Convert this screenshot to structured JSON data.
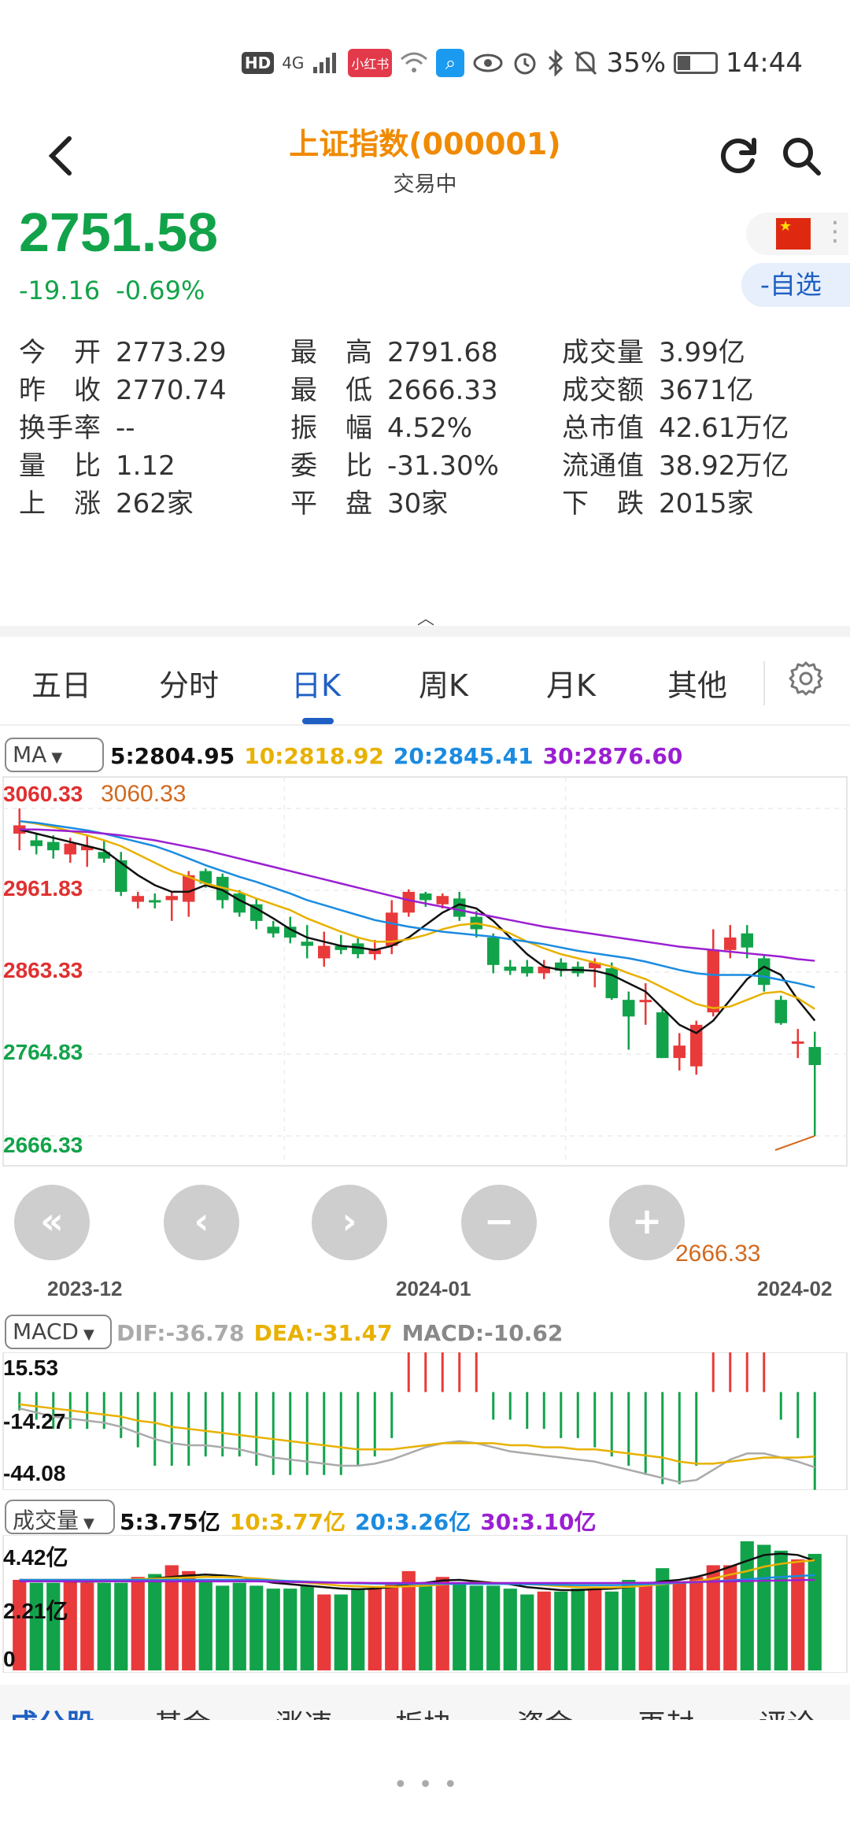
{
  "status_bar": {
    "hd": "HD",
    "network": "4G",
    "battery_pct": "35%",
    "time": "14:44",
    "battery_level": 0.35,
    "app_badge": "小红书"
  },
  "header": {
    "title": "上证指数(000001)",
    "subtitle": "交易中"
  },
  "quote": {
    "price": "2751.58",
    "change": "-19.16",
    "change_pct": "-0.69%",
    "watch_label": "-自选"
  },
  "stats": [
    {
      "label": "今　开",
      "value": "2773.29",
      "color": "#333333"
    },
    {
      "label": "最　高",
      "value": "2791.68",
      "color": "#333333"
    },
    {
      "label": "成交量",
      "value": "3.99亿",
      "color": "#333333"
    },
    {
      "label": "昨　收",
      "value": "2770.74",
      "color": "#333333"
    },
    {
      "label": "最　低",
      "value": "2666.33",
      "color": "#333333"
    },
    {
      "label": "成交额",
      "value": "3671亿",
      "color": "#333333"
    },
    {
      "label": "换手率",
      "value": "--",
      "color": "#333333"
    },
    {
      "label": "振　幅",
      "value": "4.52%",
      "color": "#333333"
    },
    {
      "label": "总市值",
      "value": "42.61万亿",
      "color": "#333333"
    },
    {
      "label": "量　比",
      "value": "1.12",
      "color": "#333333"
    },
    {
      "label": "委　比",
      "value": "-31.30%",
      "color": "#333333"
    },
    {
      "label": "流通值",
      "value": "38.92万亿",
      "color": "#333333"
    },
    {
      "label": "上　涨",
      "value": "262家",
      "color": "#333333"
    },
    {
      "label": "平　盘",
      "value": "30家",
      "color": "#333333"
    },
    {
      "label": "下　跌",
      "value": "2015家",
      "color": "#333333"
    }
  ],
  "tabs": [
    "五日",
    "分时",
    "日K",
    "周K",
    "月K",
    "其他"
  ],
  "active_tab": "日K",
  "ma_panel": {
    "selector": "MA",
    "legend": [
      {
        "text": "5:2804.95",
        "color": "#111111"
      },
      {
        "text": "10:2818.92",
        "color": "#e8b100"
      },
      {
        "text": "20:2845.41",
        "color": "#1a8be0"
      },
      {
        "text": "30:2876.60",
        "color": "#9b1fd1"
      }
    ],
    "y_labels": [
      {
        "text": "3060.33",
        "color": "#e03030"
      },
      {
        "text": "2961.83",
        "color": "#e03030"
      },
      {
        "text": "2863.33",
        "color": "#e03030"
      },
      {
        "text": "2764.83",
        "color": "#12a34a"
      },
      {
        "text": "2666.33",
        "color": "#12a34a"
      }
    ],
    "high_marker": "3060.33",
    "low_marker": "2666.33",
    "x_labels": [
      "2023-12",
      "2024-01",
      "2024-02"
    ]
  },
  "macd_panel": {
    "selector": "MACD",
    "legend": [
      {
        "text": "DIF:-36.78",
        "color": "#aaaaaa"
      },
      {
        "text": "DEA:-31.47",
        "color": "#e8b100"
      },
      {
        "text": "MACD:-10.62",
        "color": "#888888"
      }
    ],
    "y_labels": [
      "15.53",
      "-14.27",
      "-44.08"
    ]
  },
  "volume_panel": {
    "selector": "成交量",
    "legend": [
      {
        "text": "5:3.75亿",
        "color": "#111111"
      },
      {
        "text": "10:3.77亿",
        "color": "#e8b100"
      },
      {
        "text": "20:3.26亿",
        "color": "#1a8be0"
      },
      {
        "text": "30:3.10亿",
        "color": "#9b1fd1"
      }
    ],
    "y_labels": [
      "4.42亿",
      "2.21亿",
      "0"
    ]
  },
  "nav_buttons": [
    "«",
    "‹",
    "›",
    "−",
    "+"
  ],
  "bottom_tabs": [
    "成分股",
    "基金",
    "涨速",
    "板块",
    "资金",
    "再封",
    "评论"
  ],
  "colors": {
    "up": "#e83a3a",
    "down": "#12a34a",
    "accent": "#1f5fc4",
    "title": "#f08a00"
  },
  "chart_data": {
    "type": "candlestick",
    "title": "上证指数(000001) 日K",
    "ylim": [
      2666.33,
      3060.33
    ],
    "x_ticks": [
      "2023-12",
      "2024-01",
      "2024-02"
    ],
    "candles": [
      {
        "o": 3030,
        "h": 3060.33,
        "l": 3010,
        "c": 3040
      },
      {
        "o": 3022,
        "h": 3030,
        "l": 3005,
        "c": 3015
      },
      {
        "o": 3020,
        "h": 3028,
        "l": 3000,
        "c": 3010
      },
      {
        "o": 3005,
        "h": 3025,
        "l": 2995,
        "c": 3018
      },
      {
        "o": 3010,
        "h": 3028,
        "l": 2990,
        "c": 3015
      },
      {
        "o": 3008,
        "h": 3022,
        "l": 2995,
        "c": 3000
      },
      {
        "o": 2998,
        "h": 3008,
        "l": 2955,
        "c": 2960
      },
      {
        "o": 2948,
        "h": 2960,
        "l": 2940,
        "c": 2955
      },
      {
        "o": 2950,
        "h": 2958,
        "l": 2940,
        "c": 2948
      },
      {
        "o": 2950,
        "h": 2960,
        "l": 2925,
        "c": 2955
      },
      {
        "o": 2948,
        "h": 2985,
        "l": 2930,
        "c": 2980
      },
      {
        "o": 2985,
        "h": 2988,
        "l": 2965,
        "c": 2970
      },
      {
        "o": 2978,
        "h": 2982,
        "l": 2940,
        "c": 2950
      },
      {
        "o": 2958,
        "h": 2962,
        "l": 2930,
        "c": 2935
      },
      {
        "o": 2945,
        "h": 2952,
        "l": 2915,
        "c": 2925
      },
      {
        "o": 2918,
        "h": 2925,
        "l": 2905,
        "c": 2910
      },
      {
        "o": 2918,
        "h": 2930,
        "l": 2898,
        "c": 2905
      },
      {
        "o": 2900,
        "h": 2920,
        "l": 2880,
        "c": 2895
      },
      {
        "o": 2880,
        "h": 2912,
        "l": 2870,
        "c": 2895
      },
      {
        "o": 2895,
        "h": 2908,
        "l": 2885,
        "c": 2890
      },
      {
        "o": 2898,
        "h": 2905,
        "l": 2880,
        "c": 2885
      },
      {
        "o": 2885,
        "h": 2902,
        "l": 2878,
        "c": 2890
      },
      {
        "o": 2895,
        "h": 2950,
        "l": 2885,
        "c": 2935
      },
      {
        "o": 2935,
        "h": 2963,
        "l": 2930,
        "c": 2960
      },
      {
        "o": 2958,
        "h": 2960,
        "l": 2942,
        "c": 2950
      },
      {
        "o": 2945,
        "h": 2958,
        "l": 2940,
        "c": 2955
      },
      {
        "o": 2952,
        "h": 2960,
        "l": 2925,
        "c": 2930
      },
      {
        "o": 2930,
        "h": 2937,
        "l": 2905,
        "c": 2915
      },
      {
        "o": 2905,
        "h": 2910,
        "l": 2862,
        "c": 2872
      },
      {
        "o": 2870,
        "h": 2878,
        "l": 2860,
        "c": 2865
      },
      {
        "o": 2870,
        "h": 2878,
        "l": 2858,
        "c": 2862
      },
      {
        "o": 2862,
        "h": 2878,
        "l": 2855,
        "c": 2870
      },
      {
        "o": 2875,
        "h": 2880,
        "l": 2858,
        "c": 2865
      },
      {
        "o": 2870,
        "h": 2876,
        "l": 2858,
        "c": 2862
      },
      {
        "o": 2868,
        "h": 2880,
        "l": 2845,
        "c": 2875
      },
      {
        "o": 2868,
        "h": 2875,
        "l": 2830,
        "c": 2832
      },
      {
        "o": 2830,
        "h": 2840,
        "l": 2770,
        "c": 2810
      },
      {
        "o": 2830,
        "h": 2850,
        "l": 2800,
        "c": 2830
      },
      {
        "o": 2815,
        "h": 2820,
        "l": 2760,
        "c": 2760
      },
      {
        "o": 2760,
        "h": 2790,
        "l": 2745,
        "c": 2775
      },
      {
        "o": 2750,
        "h": 2805,
        "l": 2740,
        "c": 2800
      },
      {
        "o": 2815,
        "h": 2915,
        "l": 2810,
        "c": 2890
      },
      {
        "o": 2890,
        "h": 2920,
        "l": 2880,
        "c": 2905
      },
      {
        "o": 2910,
        "h": 2920,
        "l": 2880,
        "c": 2893
      },
      {
        "o": 2880,
        "h": 2885,
        "l": 2840,
        "c": 2848
      },
      {
        "o": 2830,
        "h": 2835,
        "l": 2800,
        "c": 2802
      },
      {
        "o": 2780,
        "h": 2795,
        "l": 2760,
        "c": 2780
      },
      {
        "o": 2773.29,
        "h": 2791.68,
        "l": 2666.33,
        "c": 2751.58
      }
    ],
    "ma5": [
      3035,
      3030,
      3025,
      3020,
      3015,
      3010,
      2995,
      2980,
      2968,
      2960,
      2960,
      2968,
      2962,
      2950,
      2940,
      2928,
      2915,
      2905,
      2900,
      2895,
      2893,
      2890,
      2895,
      2905,
      2920,
      2935,
      2945,
      2940,
      2925,
      2905,
      2885,
      2870,
      2866,
      2866,
      2865,
      2860,
      2850,
      2840,
      2820,
      2800,
      2790,
      2805,
      2830,
      2855,
      2870,
      2860,
      2830,
      2805
    ],
    "ma10": [
      3045,
      3042,
      3038,
      3033,
      3028,
      3022,
      3015,
      3005,
      2995,
      2985,
      2978,
      2970,
      2965,
      2960,
      2952,
      2945,
      2938,
      2928,
      2920,
      2912,
      2905,
      2900,
      2900,
      2903,
      2908,
      2915,
      2920,
      2922,
      2918,
      2910,
      2900,
      2892,
      2885,
      2880,
      2875,
      2870,
      2862,
      2855,
      2845,
      2835,
      2825,
      2820,
      2822,
      2830,
      2838,
      2840,
      2832,
      2819
    ],
    "ma20": [
      3045,
      3043,
      3040,
      3037,
      3034,
      3030,
      3025,
      3020,
      3015,
      3008,
      3000,
      2992,
      2985,
      2978,
      2972,
      2965,
      2958,
      2950,
      2944,
      2938,
      2932,
      2926,
      2922,
      2918,
      2915,
      2912,
      2910,
      2908,
      2906,
      2903,
      2900,
      2897,
      2893,
      2889,
      2886,
      2883,
      2880,
      2876,
      2871,
      2866,
      2862,
      2860,
      2860,
      2860,
      2858,
      2854,
      2850,
      2845
    ],
    "ma30": [
      3035,
      3035,
      3034,
      3033,
      3032,
      3030,
      3028,
      3025,
      3022,
      3018,
      3014,
      3010,
      3005,
      3000,
      2995,
      2990,
      2985,
      2980,
      2975,
      2970,
      2965,
      2960,
      2955,
      2950,
      2946,
      2942,
      2938,
      2934,
      2930,
      2926,
      2922,
      2918,
      2915,
      2912,
      2909,
      2906,
      2903,
      2900,
      2897,
      2894,
      2892,
      2890,
      2888,
      2886,
      2884,
      2882,
      2879,
      2877
    ],
    "macd": {
      "ylim": [
        -44.08,
        15.53
      ],
      "dif": [
        -8,
        -10,
        -12,
        -13,
        -14,
        -15,
        -17,
        -20,
        -23,
        -25,
        -26,
        -26,
        -27,
        -28,
        -30,
        -32,
        -33,
        -34,
        -35,
        -36,
        -36,
        -35,
        -33,
        -30,
        -27,
        -25,
        -24,
        -25,
        -27,
        -29,
        -30,
        -31,
        -32,
        -33,
        -34,
        -36,
        -38,
        -40,
        -42,
        -44,
        -43,
        -38,
        -33,
        -30,
        -30,
        -32,
        -34,
        -36.78
      ],
      "dea": [
        -6,
        -7,
        -8,
        -9,
        -10,
        -11,
        -12,
        -14,
        -15,
        -17,
        -18,
        -19,
        -20,
        -21,
        -22,
        -23,
        -24,
        -25,
        -26,
        -27,
        -28,
        -28,
        -28,
        -27,
        -26,
        -25,
        -25,
        -25,
        -25,
        -26,
        -26,
        -27,
        -27,
        -28,
        -28,
        -29,
        -30,
        -31,
        -32,
        -34,
        -35,
        -35,
        -34,
        -33,
        -32,
        -32,
        -32,
        -31.47
      ],
      "hist": [
        -2,
        -3,
        -4,
        -4,
        -4,
        -4,
        -5,
        -6,
        -8,
        -8,
        -8,
        -7,
        -7,
        -7,
        -8,
        -9,
        -9,
        -9,
        -9,
        -9,
        -8,
        -7,
        -5,
        5,
        8,
        10,
        10,
        8,
        -3,
        -3,
        -4,
        -4,
        -5,
        -5,
        -6,
        -7,
        -8,
        -9,
        -10,
        -10,
        -8,
        5,
        8,
        10,
        7,
        -3,
        -5,
        -10.62
      ]
    },
    "volume": {
      "ymax": 4.42,
      "values": [
        3.1,
        3.0,
        3.0,
        3.1,
        3.0,
        3.0,
        3.0,
        3.2,
        3.3,
        3.6,
        3.4,
        3.1,
        2.9,
        3.0,
        2.9,
        2.8,
        2.8,
        2.9,
        2.6,
        2.6,
        2.8,
        2.8,
        3.0,
        3.4,
        3.0,
        3.2,
        3.0,
        2.9,
        2.9,
        2.8,
        2.6,
        2.7,
        2.7,
        2.8,
        2.8,
        2.7,
        3.1,
        2.9,
        3.5,
        3.0,
        3.2,
        3.6,
        3.6,
        4.42,
        4.3,
        4.1,
        3.8,
        3.99
      ],
      "ma5": [
        3.1,
        3.08,
        3.06,
        3.05,
        3.04,
        3.05,
        3.07,
        3.1,
        3.15,
        3.2,
        3.25,
        3.28,
        3.25,
        3.2,
        3.1,
        3.0,
        2.95,
        2.9,
        2.85,
        2.8,
        2.78,
        2.8,
        2.85,
        2.95,
        3.0,
        3.08,
        3.1,
        3.05,
        3.0,
        2.95,
        2.85,
        2.8,
        2.75,
        2.75,
        2.78,
        2.8,
        2.85,
        2.95,
        3.05,
        3.1,
        3.2,
        3.35,
        3.55,
        3.75,
        3.95,
        4.0,
        3.95,
        3.75
      ],
      "ma10": [
        3.1,
        3.1,
        3.1,
        3.1,
        3.1,
        3.1,
        3.1,
        3.12,
        3.14,
        3.16,
        3.18,
        3.2,
        3.2,
        3.18,
        3.15,
        3.1,
        3.05,
        3.0,
        2.95,
        2.9,
        2.88,
        2.86,
        2.86,
        2.88,
        2.9,
        2.94,
        2.98,
        3.0,
        3.0,
        2.98,
        2.95,
        2.92,
        2.88,
        2.85,
        2.84,
        2.84,
        2.86,
        2.9,
        2.95,
        3.0,
        3.05,
        3.15,
        3.28,
        3.4,
        3.55,
        3.65,
        3.72,
        3.77
      ],
      "ma20": [
        3.1,
        3.1,
        3.1,
        3.1,
        3.1,
        3.1,
        3.1,
        3.1,
        3.1,
        3.1,
        3.1,
        3.1,
        3.1,
        3.1,
        3.1,
        3.08,
        3.06,
        3.04,
        3.02,
        3.0,
        2.98,
        2.97,
        2.96,
        2.96,
        2.96,
        2.96,
        2.96,
        2.96,
        2.96,
        2.96,
        2.95,
        2.94,
        2.93,
        2.92,
        2.92,
        2.92,
        2.93,
        2.95,
        2.97,
        3.0,
        3.02,
        3.05,
        3.08,
        3.12,
        3.16,
        3.2,
        3.23,
        3.26
      ],
      "ma30": [
        3.05,
        3.05,
        3.05,
        3.05,
        3.05,
        3.05,
        3.05,
        3.05,
        3.05,
        3.05,
        3.05,
        3.05,
        3.05,
        3.05,
        3.05,
        3.04,
        3.03,
        3.02,
        3.01,
        3.0,
        3.0,
        2.99,
        2.99,
        2.99,
        2.99,
        2.99,
        2.99,
        2.99,
        2.99,
        2.99,
        2.99,
        2.99,
        2.99,
        2.99,
        2.99,
        2.99,
        3.0,
        3.0,
        3.01,
        3.02,
        3.03,
        3.04,
        3.05,
        3.06,
        3.07,
        3.08,
        3.09,
        3.1
      ]
    }
  }
}
